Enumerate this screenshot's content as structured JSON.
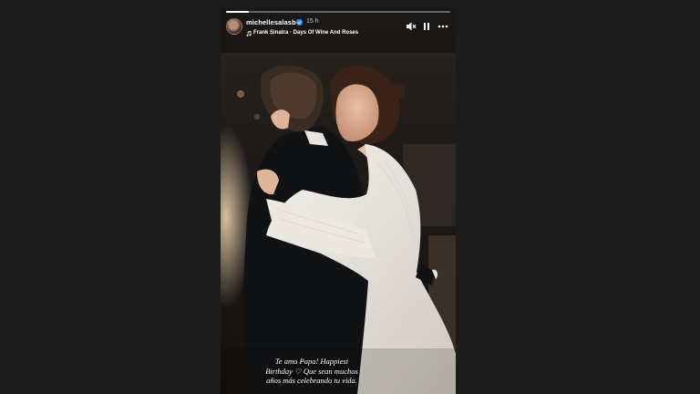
{
  "story": {
    "username": "michellesalasb",
    "time_ago": "15 h",
    "music": "Frank Sinatra · Days Of Wine And Roses",
    "progress_fraction": 0.1,
    "caption_lines": [
      "Te amo Papa! Happiest",
      "Birthday ♡ Que sean muchos",
      "años más celebrando tu vida."
    ]
  },
  "icons": {
    "verified": "verified-badge-icon",
    "music": "music-note-icon",
    "mute": "speaker-muted-icon",
    "pause": "pause-icon",
    "more": "more-options-icon"
  },
  "colors": {
    "background": "#1c1c1c",
    "text": "#ffffff"
  }
}
